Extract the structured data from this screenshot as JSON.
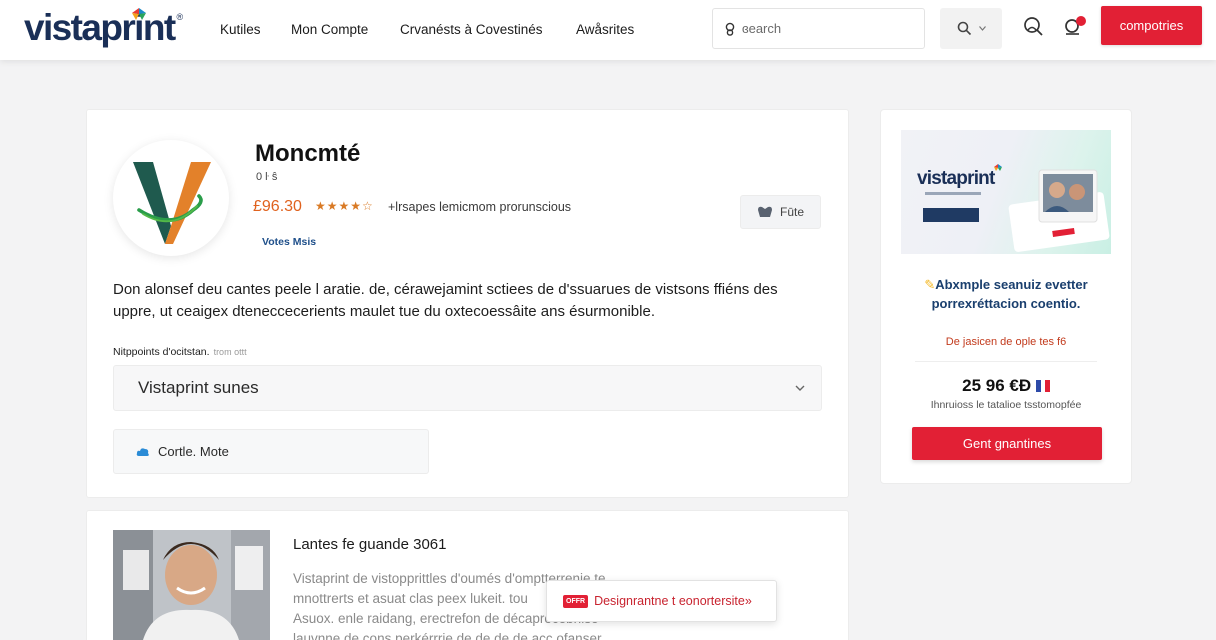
{
  "header": {
    "logo_text": "vistaprint",
    "logo_reg": "®",
    "nav": [
      {
        "label": "Kutiles"
      },
      {
        "label": "Mon Compte"
      },
      {
        "label": "Crvanésts  à Covestinés"
      },
      {
        "label": "Awåsrites"
      }
    ],
    "search": {
      "placeholder": "ɞearch"
    },
    "account_button": "compotries",
    "colors": {
      "brand": "#1a2f57",
      "accent": "#e22035"
    }
  },
  "product": {
    "title": "Moncmté",
    "subtitle": "0 ŀ ŝ",
    "price": "£96.30",
    "stars": "★★★★☆",
    "rating_note": "+lrsapes lemicmom prorunscious",
    "badge": "Votes Msis",
    "favorite_label": "Fūte",
    "description": "Don alonsef deu cantes peele l aratie. de, cérawejamint sctiees de d'ssuarues de vistsons ffiéns des uppre, ut ceaigex dteneccecerients maulet tue du oxtecoessâite ans ésurmonible.",
    "option_label": "Nitppoints d'ocitstan.",
    "option_label_small": "trom ottt",
    "option_value": "Vistaprint sunes",
    "contact_label": "Cortle. Mote"
  },
  "review": {
    "title": "Lantes fe guande 3061",
    "lines": [
      "Vistaprint de vistopprittles d'oumés d'omptterrenie te",
      "mnottrerts et asuat clas peex lukeit. tou",
      "Asuox. enle raidang, erectrefon de décaprocebnise",
      "lauvnne de cons perkérrrie de de de de acc ofanser"
    ]
  },
  "toast": {
    "badge": "OFFR",
    "text": "Designrantne t eonortersite»"
  },
  "side_ad": {
    "banner_logo": "vistaprint",
    "headline": "Abxmple seanuiz evetter porrexréttacion coentio.",
    "sub": "De jasicen de ople tes f6",
    "price": "25 96 €Ɖ",
    "price_note": "Ihnruioss le tatalioe tsstomopfée",
    "cta": "Gent gnantines"
  }
}
